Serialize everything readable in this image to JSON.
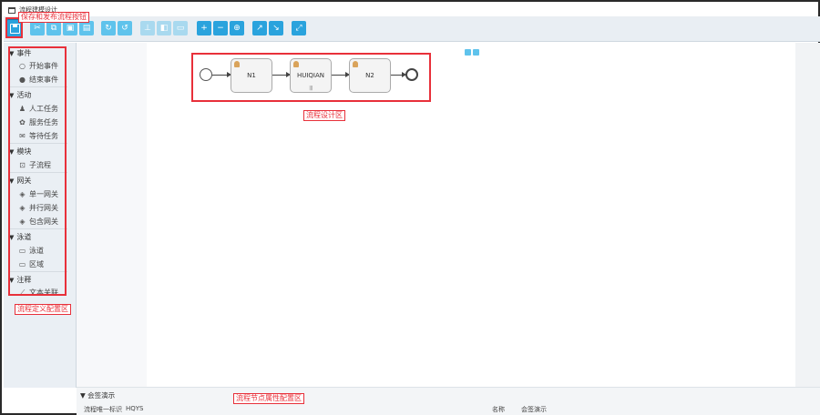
{
  "window": {
    "title": "流程建模设计"
  },
  "toolbar": {
    "buttons": [
      {
        "name": "save",
        "glyph": ""
      },
      {
        "name": "cut",
        "glyph": "✂"
      },
      {
        "name": "copy",
        "glyph": "⧉"
      },
      {
        "name": "paste",
        "glyph": "▣"
      },
      {
        "name": "delete",
        "glyph": "▤"
      },
      {
        "name": "redo",
        "glyph": "↻"
      },
      {
        "name": "undo",
        "glyph": "↺"
      },
      {
        "name": "align",
        "glyph": "⊥"
      },
      {
        "name": "stencil",
        "glyph": "◧"
      },
      {
        "name": "group",
        "glyph": "▭"
      },
      {
        "name": "zoom-in",
        "glyph": "+"
      },
      {
        "name": "zoom-out",
        "glyph": "−"
      },
      {
        "name": "zoom-fit",
        "glyph": "⊕"
      },
      {
        "name": "bend-add",
        "glyph": "↗"
      },
      {
        "name": "bend-remove",
        "glyph": "↘"
      },
      {
        "name": "fullscreen",
        "glyph": "⤢"
      }
    ]
  },
  "annotations": {
    "save_publish": "保存和发布流程按钮",
    "design_area": "流程设计区",
    "definition_area": "流程定义配置区",
    "property_area": "流程节点属性配置区"
  },
  "sidebar": {
    "sections": [
      {
        "title": "事件",
        "items": [
          {
            "label": "开始事件",
            "icon": "○"
          },
          {
            "label": "结束事件",
            "icon": "●"
          }
        ]
      },
      {
        "title": "活动",
        "items": [
          {
            "label": "人工任务",
            "icon": "♟"
          },
          {
            "label": "服务任务",
            "icon": "✿"
          },
          {
            "label": "等待任务",
            "icon": "✉"
          }
        ]
      },
      {
        "title": "模块",
        "items": [
          {
            "label": "子流程",
            "icon": "⊡"
          }
        ]
      },
      {
        "title": "网关",
        "items": [
          {
            "label": "单一网关",
            "icon": "◈"
          },
          {
            "label": "并行网关",
            "icon": "◈"
          },
          {
            "label": "包含网关",
            "icon": "◈"
          }
        ]
      },
      {
        "title": "泳道",
        "items": [
          {
            "label": "泳道",
            "icon": "▭"
          },
          {
            "label": "区域",
            "icon": "▭"
          }
        ]
      },
      {
        "title": "注释",
        "items": [
          {
            "label": "文本关联",
            "icon": "⟋"
          }
        ]
      }
    ]
  },
  "diagram": {
    "nodes": [
      {
        "id": "N1",
        "label": "N1",
        "multi": false
      },
      {
        "id": "HUIQIAN",
        "label": "HUIQIAN",
        "multi": true,
        "multi_marker": "|||"
      },
      {
        "id": "N2",
        "label": "N2",
        "multi": false
      }
    ]
  },
  "properties": {
    "section_title": "会签演示",
    "id_label": "流程唯一标识",
    "id_value": "HQYS",
    "name_label": "名称",
    "name_value": "会签演示"
  },
  "colors": {
    "accent": "#2aa3dd",
    "annotation": "#e8303a"
  }
}
